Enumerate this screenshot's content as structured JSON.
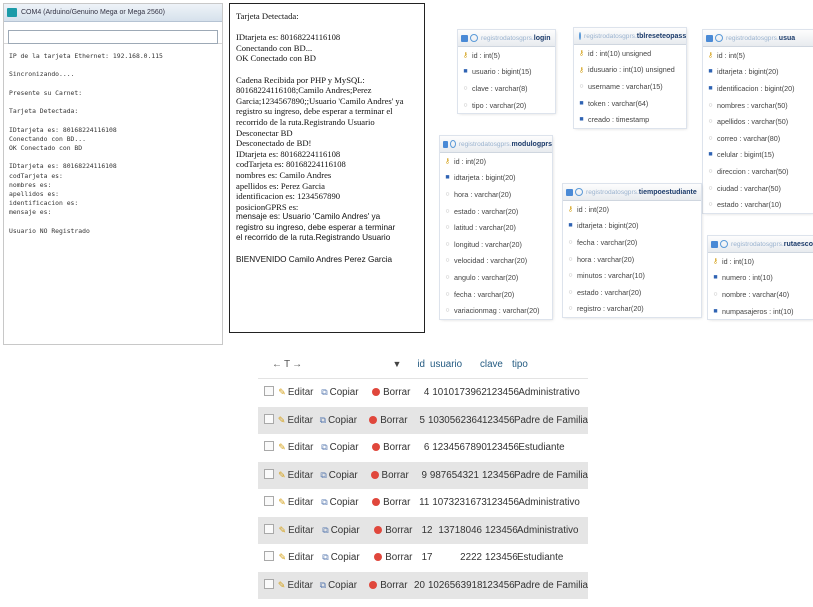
{
  "serial": {
    "title": "COM4 (Arduino/Genuino Mega or Mega 2560)",
    "input_value": "",
    "lines": [
      "IP de la tarjeta Ethernet: 192.168.0.115",
      "",
      "Sincronizando....",
      "",
      "Presente su Carnet:",
      "",
      "Tarjeta Detectada:",
      "",
      "IDtarjeta es: 80168224116108",
      "Conectando con BD...",
      "OK Conectado con BD",
      "",
      "IDtarjeta es: 80168224116108",
      "codTarjeta es:",
      "nombres es:",
      "apellidos es:",
      "identificacion es:",
      "mensaje es:",
      "",
      "Usuario NO Registrado"
    ]
  },
  "response_box": {
    "lines": [
      "Tarjeta Detectada:",
      "",
      "IDtarjeta es: 80168224116108",
      "Conectando con BD...",
      "OK Conectado con BD",
      "",
      "Cadena Recibida por PHP y MySQL:",
      "80168224116108;Camilo Andres;Perez",
      "Garcia;1234567890;;Usuario 'Camilo Andres' ya",
      "registro su ingreso, debe esperar a terminar el",
      "recorrido de la ruta.Registrando Usuario",
      "Desconectar BD",
      "Desconectado de BD!",
      "IDtarjeta es: 80168224116108",
      "codTarjeta es: 80168224116108",
      "nombres es: Camilo Andres",
      "apellidos es: Perez Garcia",
      "identificacion es: 1234567890",
      "posicionGPRS es:",
      "mensaje es: Usuario 'Camilo Andres' ya",
      "registro su ingreso, debe esperar a terminar",
      "el recorrido de la ruta.Registrando Usuario",
      "",
      "BIENVENIDO Camilo Andres Perez Garcia"
    ]
  },
  "db_tables": [
    {
      "db": "registrodatosgprs",
      "name": "login",
      "fields": [
        {
          "key": "key",
          "text": "id : int(5)"
        },
        {
          "key": "idx",
          "text": "usuario : bigint(15)"
        },
        {
          "key": "col",
          "text": "clave : varchar(8)"
        },
        {
          "key": "col",
          "text": "tipo : varchar(20)"
        }
      ]
    },
    {
      "db": "registrodatosgprs",
      "name": "tblreseteopass",
      "fields": [
        {
          "key": "key",
          "text": "id : int(10) unsigned"
        },
        {
          "key": "key",
          "text": "idusuario : int(10) unsigned"
        },
        {
          "key": "col",
          "text": "username : varchar(15)"
        },
        {
          "key": "idx",
          "text": "token : varchar(64)"
        },
        {
          "key": "idx",
          "text": "creado : timestamp"
        }
      ]
    },
    {
      "db": "registrodatosgprs",
      "name": "usua",
      "fields": [
        {
          "key": "key",
          "text": "id : int(5)"
        },
        {
          "key": "idx",
          "text": "idtarjeta : bigint(20)"
        },
        {
          "key": "idx",
          "text": "identificacion : bigint(20)"
        },
        {
          "key": "col",
          "text": "nombres : varchar(50)"
        },
        {
          "key": "col",
          "text": "apellidos : varchar(50)"
        },
        {
          "key": "col",
          "text": "correo : varchar(80)"
        },
        {
          "key": "idx",
          "text": "celular : bigint(15)"
        },
        {
          "key": "col",
          "text": "direccion : varchar(50)"
        },
        {
          "key": "col",
          "text": "ciudad : varchar(50)"
        },
        {
          "key": "col",
          "text": "estado : varchar(10)"
        }
      ]
    },
    {
      "db": "registrodatosgprs",
      "name": "modulogprs",
      "fields": [
        {
          "key": "key",
          "text": "id : int(20)"
        },
        {
          "key": "idx",
          "text": "idtarjeta : bigint(20)"
        },
        {
          "key": "col",
          "text": "hora : varchar(20)"
        },
        {
          "key": "col",
          "text": "estado : varchar(20)"
        },
        {
          "key": "col",
          "text": "latitud : varchar(20)"
        },
        {
          "key": "col",
          "text": "longitud : varchar(20)"
        },
        {
          "key": "col",
          "text": "velocidad : varchar(20)"
        },
        {
          "key": "col",
          "text": "angulo : varchar(20)"
        },
        {
          "key": "col",
          "text": "fecha : varchar(20)"
        },
        {
          "key": "col",
          "text": "variacionmag : varchar(20)"
        }
      ]
    },
    {
      "db": "registrodatosgprs",
      "name": "tiempoestudiante",
      "fields": [
        {
          "key": "key",
          "text": "id : int(20)"
        },
        {
          "key": "idx",
          "text": "idtarjeta : bigint(20)"
        },
        {
          "key": "col",
          "text": "fecha : varchar(20)"
        },
        {
          "key": "col",
          "text": "hora : varchar(20)"
        },
        {
          "key": "col",
          "text": "minutos : varchar(10)"
        },
        {
          "key": "col",
          "text": "estado : varchar(20)"
        },
        {
          "key": "col",
          "text": "registro : varchar(20)"
        }
      ]
    },
    {
      "db": "registrodatosgprs",
      "name": "rutaesco",
      "fields": [
        {
          "key": "key",
          "text": "id : int(10)"
        },
        {
          "key": "idx",
          "text": "numero : int(10)"
        },
        {
          "key": "col",
          "text": "nombre : varchar(40)"
        },
        {
          "key": "idx",
          "text": "numpasajeros : int(10)"
        }
      ]
    }
  ],
  "pma": {
    "header": {
      "arrows": "←T→",
      "sort_icon": "▼",
      "columns": [
        "id",
        "usuario",
        "clave",
        "tipo"
      ]
    },
    "actions": {
      "edit": "Editar",
      "copy": "Copiar",
      "delete": "Borrar"
    },
    "rows": [
      {
        "id": "4",
        "usuario": "1010173962",
        "clave": "123456",
        "tipo": "Administrativo"
      },
      {
        "id": "5",
        "usuario": "1030562364",
        "clave": "123456",
        "tipo": "Padre de Familia"
      },
      {
        "id": "6",
        "usuario": "1234567890",
        "clave": "123456",
        "tipo": "Estudiante"
      },
      {
        "id": "9",
        "usuario": "987654321",
        "clave": "123456",
        "tipo": "Padre de Familia"
      },
      {
        "id": "11",
        "usuario": "1073231673",
        "clave": "123456",
        "tipo": "Administrativo"
      },
      {
        "id": "12",
        "usuario": "13718046",
        "clave": "123456",
        "tipo": "Administrativo"
      },
      {
        "id": "17",
        "usuario": "2222",
        "clave": "123456",
        "tipo": "Estudiante"
      },
      {
        "id": "20",
        "usuario": "1026563918",
        "clave": "123456",
        "tipo": "Padre de Familia"
      }
    ]
  }
}
